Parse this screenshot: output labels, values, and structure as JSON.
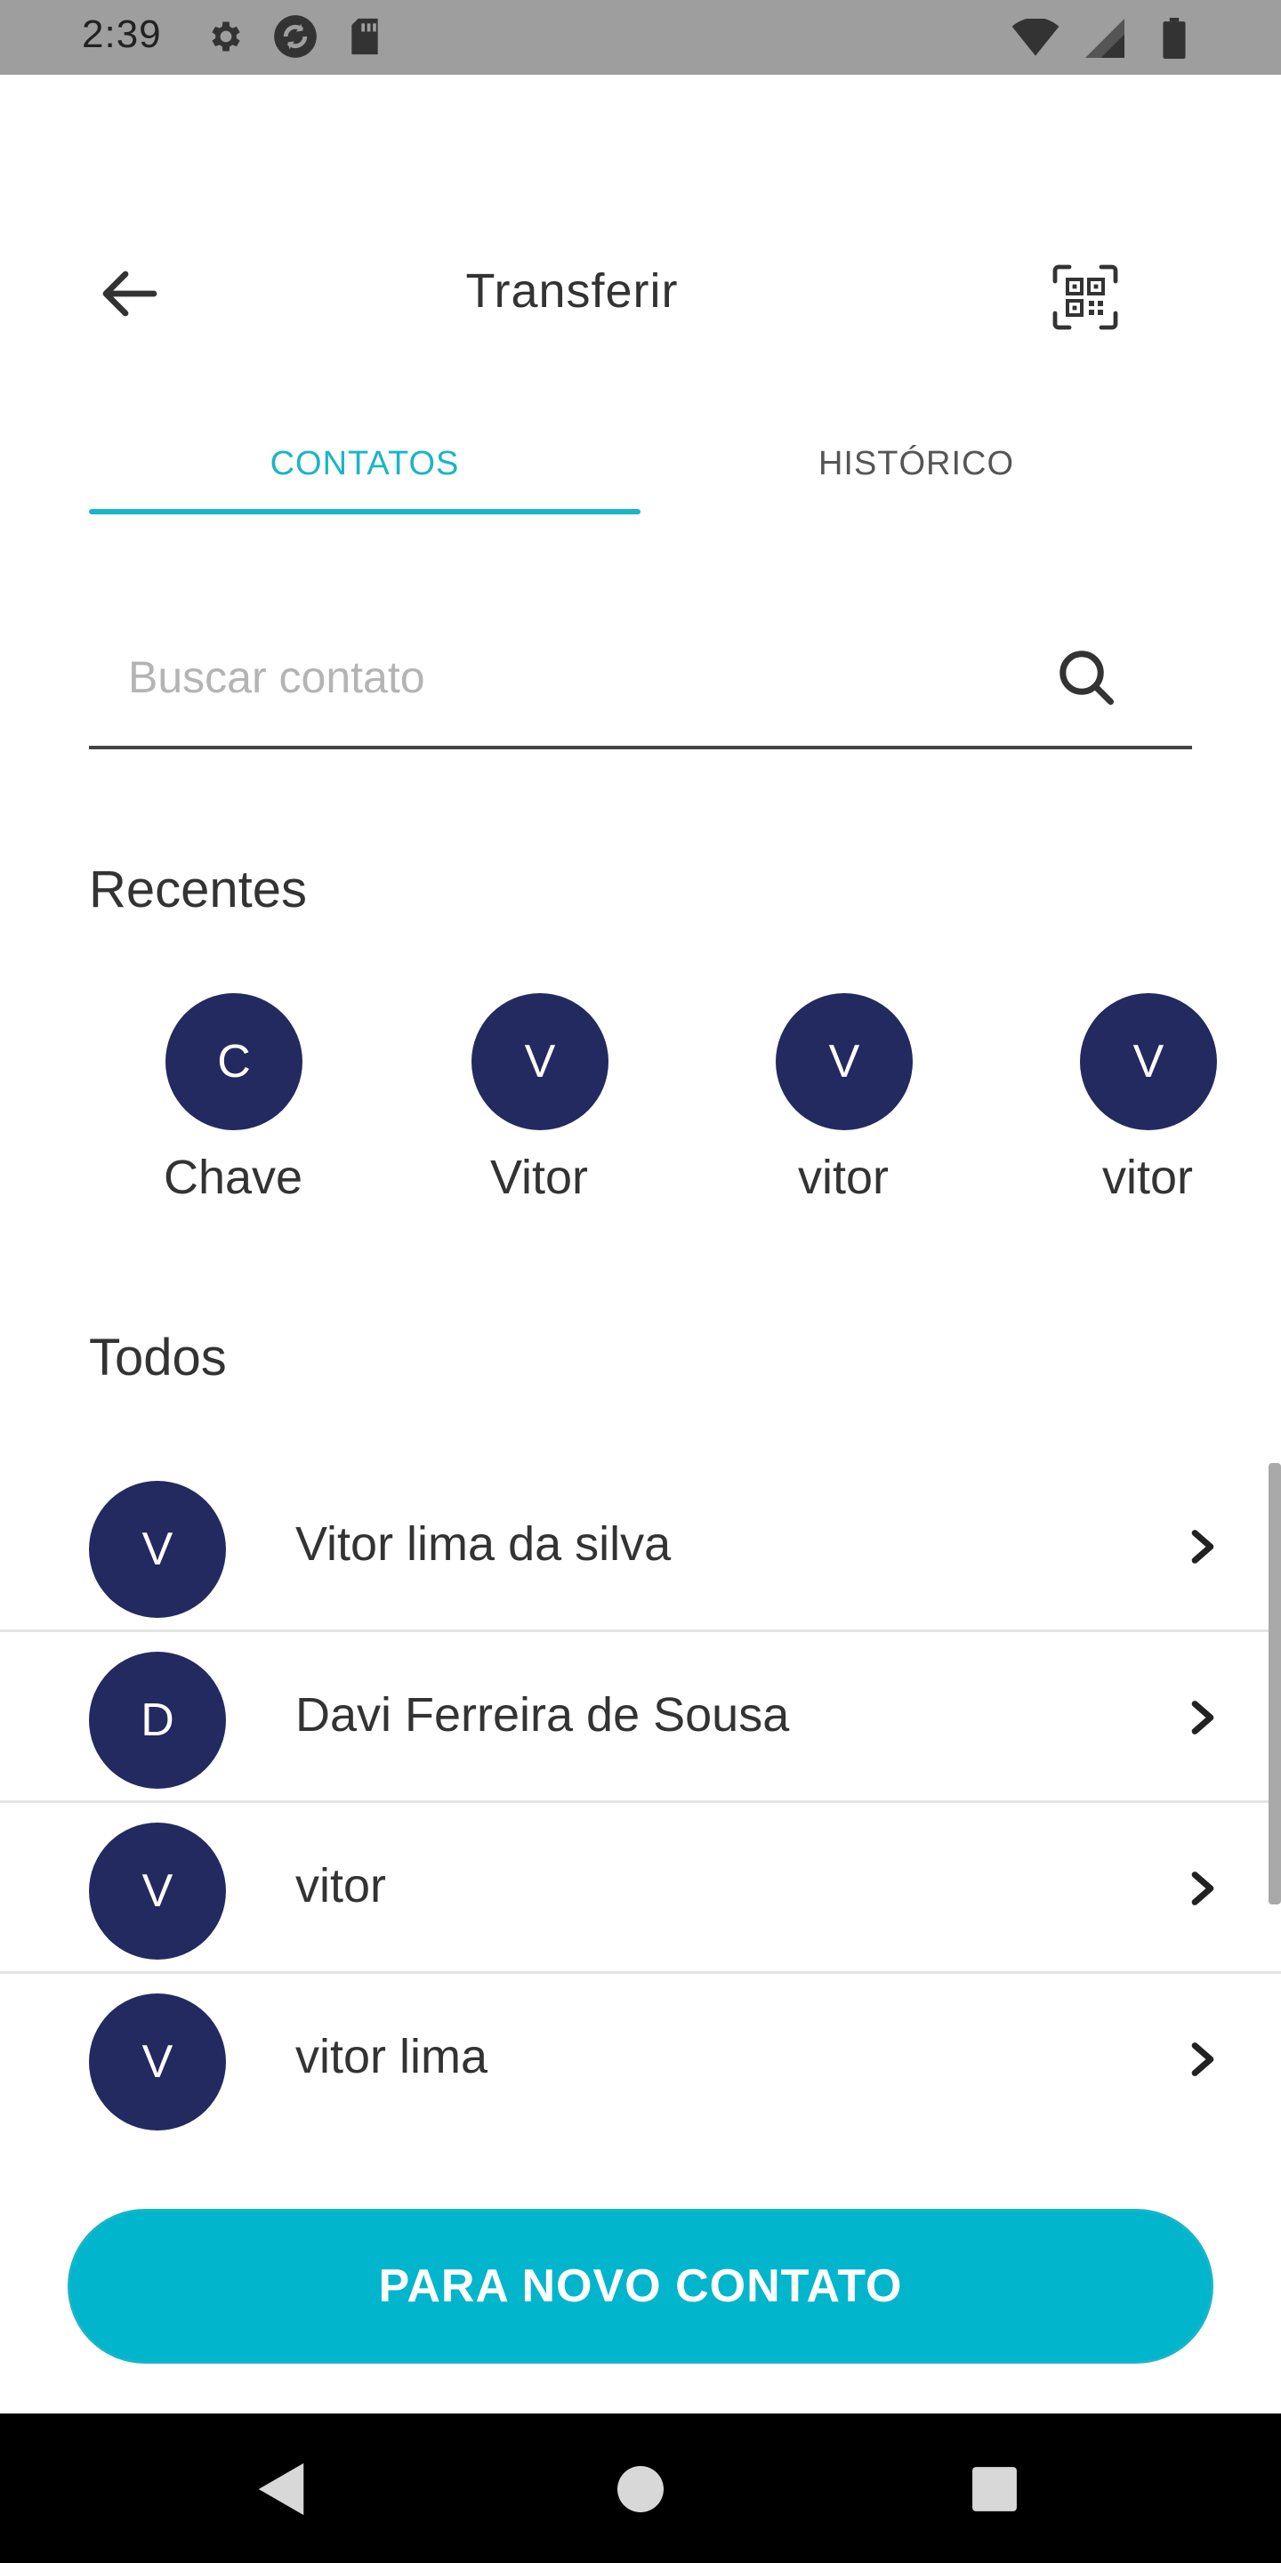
{
  "status_bar": {
    "time": "2:39",
    "icons": [
      "settings-icon",
      "sync-icon",
      "sd-card-icon",
      "wifi-icon",
      "signal-icon",
      "battery-icon"
    ]
  },
  "header": {
    "title": "Transferir",
    "back_icon": "arrow-left-icon",
    "qr_icon": "qr-code-scan-icon"
  },
  "tabs": [
    {
      "label": "CONTATOS",
      "active": true
    },
    {
      "label": "HISTÓRICO",
      "active": false
    }
  ],
  "search": {
    "placeholder": "Buscar contato",
    "value": ""
  },
  "recents": {
    "title": "Recentes",
    "items": [
      {
        "initial": "C",
        "name": "Chave"
      },
      {
        "initial": "V",
        "name": "Vitor"
      },
      {
        "initial": "V",
        "name": "vitor"
      },
      {
        "initial": "V",
        "name": "vitor"
      }
    ]
  },
  "all": {
    "title": "Todos",
    "items": [
      {
        "initial": "V",
        "name": "Vitor lima da silva"
      },
      {
        "initial": "D",
        "name": "Davi Ferreira de Sousa"
      },
      {
        "initial": "V",
        "name": "vitor"
      },
      {
        "initial": "V",
        "name": "vitor lima"
      }
    ]
  },
  "cta": {
    "label": "PARA NOVO CONTATO"
  },
  "colors": {
    "accent": "#19b5c8",
    "avatar": "#222a60",
    "status_bar": "#9e9e9e",
    "nav_bar": "#000000"
  }
}
